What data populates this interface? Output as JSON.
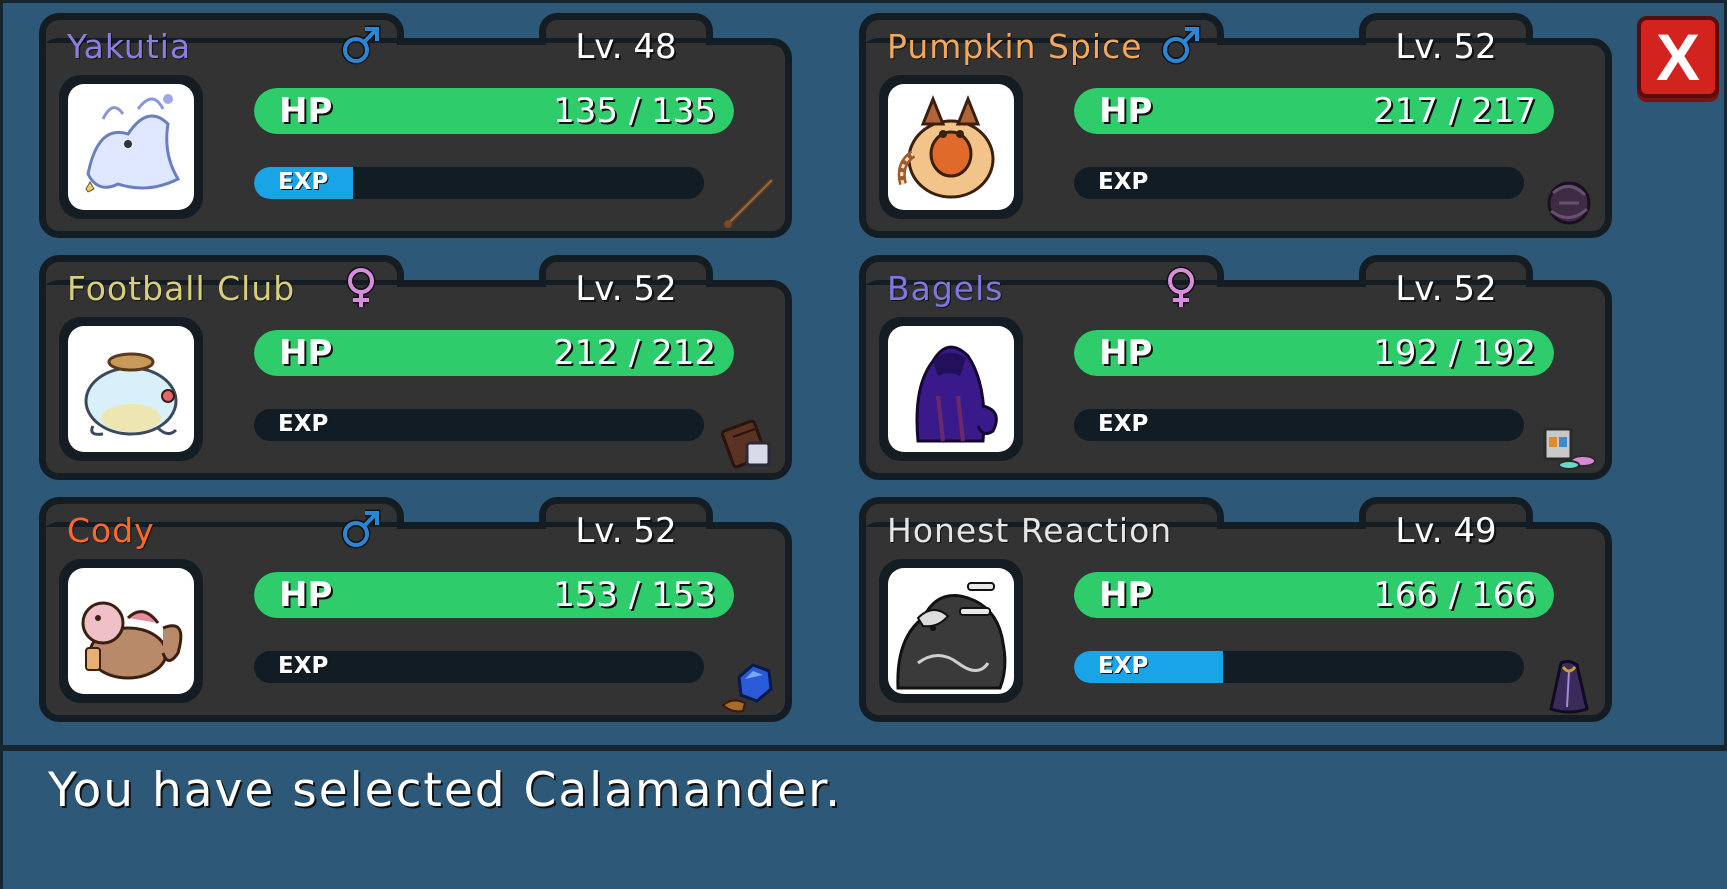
{
  "close_label": "X",
  "message": "You have selected Calamander.",
  "colors": {
    "hp": "#2ecc6b",
    "exp": "#1aa4e8",
    "male": "#2b86d6",
    "female": "#d98ce0"
  },
  "party": [
    {
      "name": "Yakutia",
      "name_color": "#8c7fe0",
      "gender": "male",
      "gender_symbol": "♂",
      "level": "Lv. 48",
      "hp_label": "HP",
      "hp": "135 / 135",
      "hp_fraction": 1.0,
      "exp_label": "EXP",
      "exp_fraction": 0.22,
      "held_item": "wand-icon",
      "creature": "ghost-dragon-icon"
    },
    {
      "name": "Pumpkin Spice",
      "name_color": "#f3a85c",
      "gender": "male",
      "gender_symbol": "♂",
      "level": "Lv. 52",
      "hp_label": "HP",
      "hp": "217 / 217",
      "hp_fraction": 1.0,
      "exp_label": "EXP",
      "exp_fraction": 0.0,
      "held_item": "shadow-orb-icon",
      "creature": "pumpkin-raccoon-icon"
    },
    {
      "name": "Football Club",
      "name_color": "#d9cf7a",
      "gender": "female",
      "gender_symbol": "♀",
      "level": "Lv. 52",
      "hp_label": "HP",
      "hp": "212 / 212",
      "hp_fraction": 1.0,
      "exp_label": "EXP",
      "exp_fraction": 0.0,
      "held_item": "chocolate-bar-icon",
      "creature": "jar-frog-icon"
    },
    {
      "name": "Bagels",
      "name_color": "#7f78e0",
      "gender": "female",
      "gender_symbol": "♀",
      "level": "Lv. 52",
      "hp_label": "HP",
      "hp": "192 / 192",
      "hp_fraction": 1.0,
      "exp_label": "EXP",
      "exp_fraction": 0.0,
      "held_item": "paint-kit-icon",
      "creature": "purple-cloak-icon"
    },
    {
      "name": "Cody",
      "name_color": "#ff6a2b",
      "gender": "male",
      "gender_symbol": "♂",
      "level": "Lv. 52",
      "hp_label": "HP",
      "hp": "153 / 153",
      "hp_fraction": 1.0,
      "exp_label": "EXP",
      "exp_fraction": 0.0,
      "held_item": "blue-gem-icon",
      "creature": "flower-cat-icon"
    },
    {
      "name": "Honest Reaction",
      "name_color": "#e6e6e6",
      "gender": "",
      "gender_symbol": "",
      "level": "Lv. 49",
      "hp_label": "HP",
      "hp": "166 / 166",
      "hp_fraction": 1.0,
      "exp_label": "EXP",
      "exp_fraction": 0.33,
      "held_item": "dark-cloak-icon",
      "creature": "bone-beast-icon"
    }
  ]
}
